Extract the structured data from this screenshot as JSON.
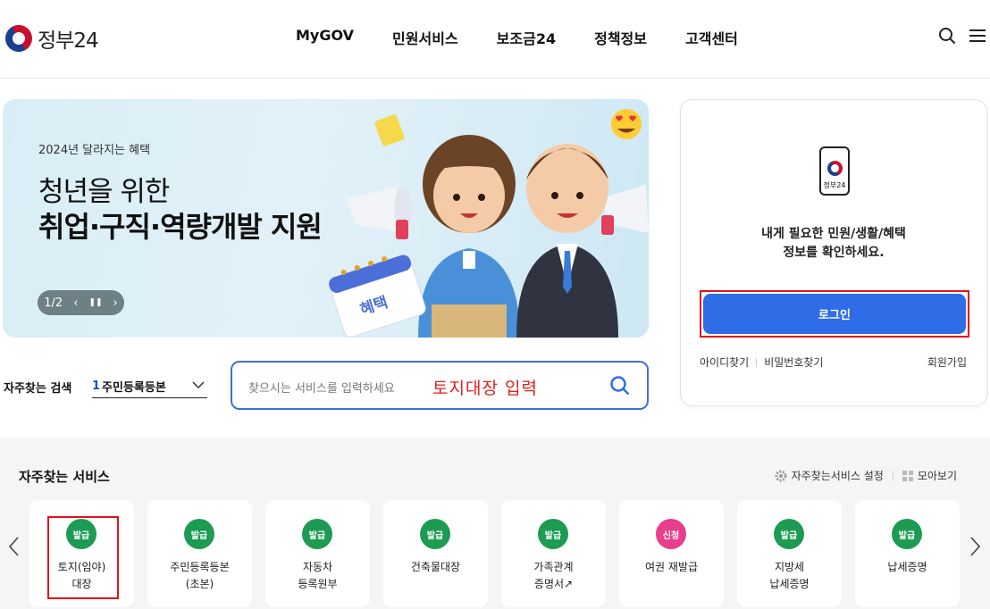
{
  "header": {
    "logo_text": "정부24",
    "nav": [
      "MyGOV",
      "민원서비스",
      "보조금24",
      "정책정보",
      "고객센터"
    ],
    "icons": [
      "search-icon",
      "menu-icon"
    ]
  },
  "banner": {
    "subtitle": "2024년 달라지는 혜택",
    "title_line1": "청년을 위한",
    "title_line2": "취업·구직·역량개발 지원",
    "pager_text": "1/2",
    "calendar_tag": "혜택"
  },
  "login": {
    "app_label": "정부24",
    "message_line1": "내게 필요한 민원/생활/혜택",
    "message_line2": "정보를 확인하세요.",
    "login_button": "로그인",
    "find_id": "아이디찾기",
    "find_pw": "비밀번호찾기",
    "join": "회원가입"
  },
  "search": {
    "freq_label": "자주찾는 검색",
    "select_num": "1",
    "select_value": "주민등록등본",
    "placeholder": "찾으시는 서비스를 입력하세요",
    "annotation": "토지대장 입력"
  },
  "services": {
    "title": "자주찾는 서비스",
    "settings_label": "자주찾는서비스 설정",
    "collect_label": "모아보기",
    "cards": [
      {
        "badge": "발급",
        "label": "토지(임야)\n대장"
      },
      {
        "badge": "발급",
        "label": "주민등록등본\n(초본)"
      },
      {
        "badge": "발급",
        "label": "자동차\n등록원부"
      },
      {
        "badge": "발급",
        "label": "건축물대장"
      },
      {
        "badge": "발급",
        "label": "가족관계\n증명서↗"
      },
      {
        "badge": "신청",
        "label": "여권 재발급"
      },
      {
        "badge": "발급",
        "label": "지방세\n납세증명"
      },
      {
        "badge": "발급",
        "label": "납세증명"
      }
    ]
  },
  "colors": {
    "primary_blue": "#2e6de6",
    "issue_green": "#1d9b53",
    "apply_pink": "#e83e8c",
    "highlight_red": "#e3121a"
  }
}
